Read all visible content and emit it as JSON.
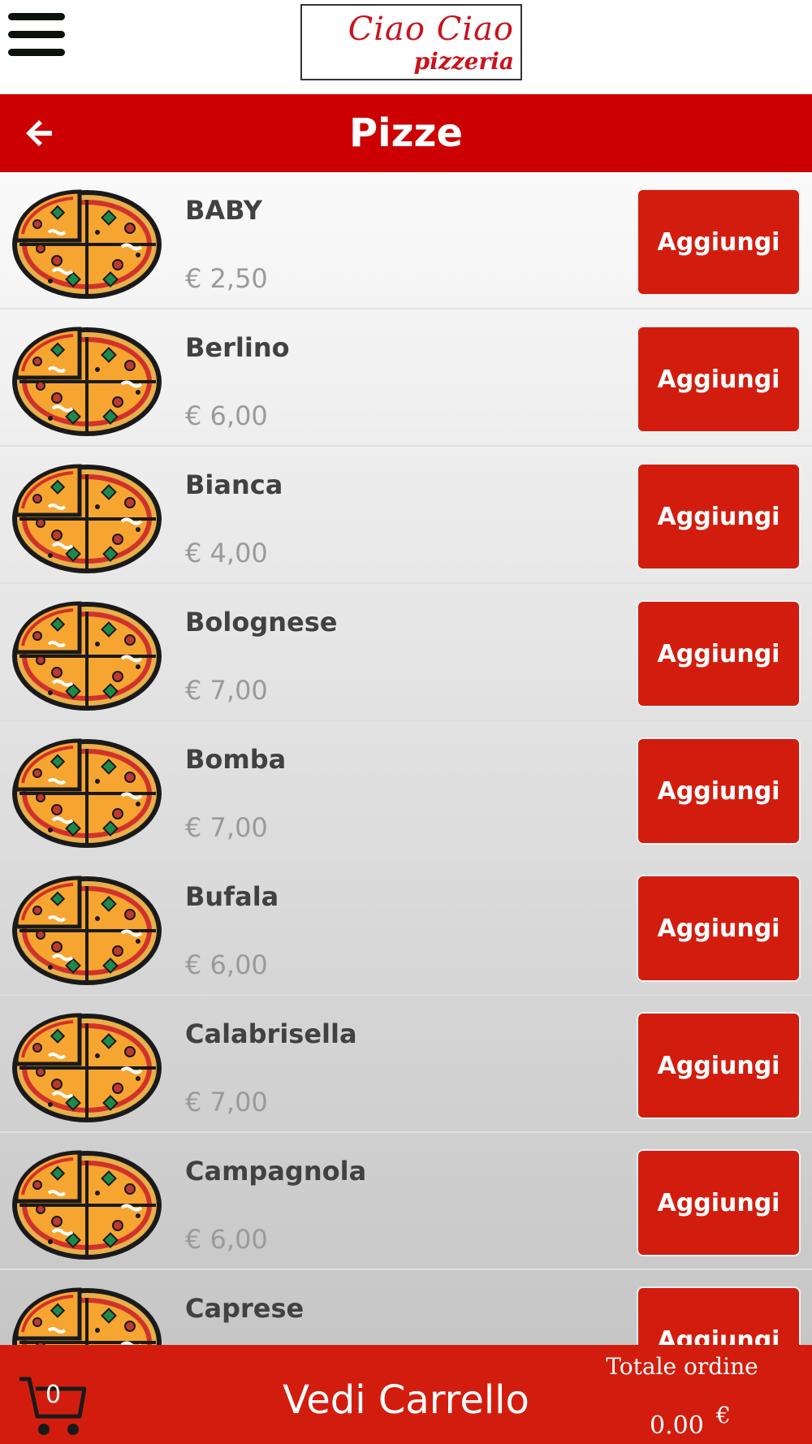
{
  "header": {
    "logo_line1": "Ciao Ciao",
    "logo_line2": "pizzeria",
    "title": "Pizze"
  },
  "icons": {
    "menu": "hamburger-menu-icon",
    "back": "back-arrow-icon",
    "product": "pizza-icon",
    "cart": "shopping-cart-icon"
  },
  "colors": {
    "brand_red": "#cc0000",
    "button_red": "#d21d0e"
  },
  "items": [
    {
      "name": "BABY",
      "price": "€ 2,50",
      "button": "Aggiungi"
    },
    {
      "name": "Berlino",
      "price": "€ 6,00",
      "button": "Aggiungi"
    },
    {
      "name": "Bianca",
      "price": "€ 4,00",
      "button": "Aggiungi"
    },
    {
      "name": "Bolognese",
      "price": "€ 7,00",
      "button": "Aggiungi"
    },
    {
      "name": "Bomba",
      "price": "€ 7,00",
      "button": "Aggiungi"
    },
    {
      "name": "Bufala",
      "price": "€ 6,00",
      "button": "Aggiungi"
    },
    {
      "name": "Calabrisella",
      "price": "€ 7,00",
      "button": "Aggiungi"
    },
    {
      "name": "Campagnola",
      "price": "€ 6,00",
      "button": "Aggiungi"
    },
    {
      "name": "Caprese",
      "price": "",
      "button": "Aggiungi"
    }
  ],
  "footer": {
    "cart_count": "0",
    "view_cart": "Vedi Carrello",
    "total_label": "Totale ordine",
    "total_value": "0.00",
    "currency": "€"
  }
}
